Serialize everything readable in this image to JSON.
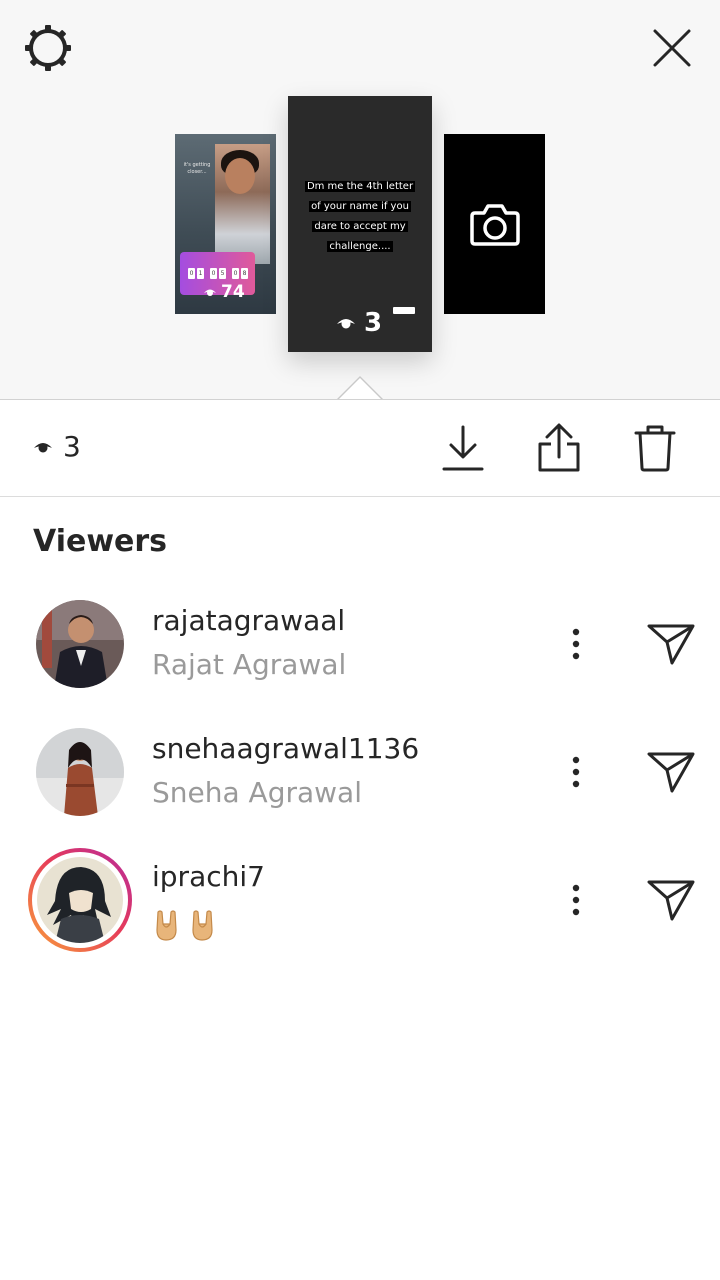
{
  "header": {
    "settings_icon": "gear-icon",
    "close_icon": "close-icon"
  },
  "stories": {
    "left": {
      "caption": "it's getting closer...",
      "countdown_digits": [
        "0",
        "1",
        "0",
        "5",
        "0",
        "8"
      ],
      "views": "74"
    },
    "center": {
      "text": "Dm me the 4th letter of your name if you dare to accept my challenge....",
      "views": "3"
    },
    "right": {
      "icon": "camera-icon"
    }
  },
  "action_bar": {
    "views": "3",
    "download_icon": "download-icon",
    "share_icon": "share-icon",
    "delete_icon": "trash-icon"
  },
  "viewers": {
    "title": "Viewers",
    "list": [
      {
        "username": "rajatagrawaal",
        "name": "Rajat Agrawal"
      },
      {
        "username": "snehaagrawal1136",
        "name": "Sneha Agrawal"
      },
      {
        "username": "iprachi7",
        "name": "🤘🤘"
      }
    ]
  },
  "colors": {
    "top_background": "#f7f7f7",
    "text_primary": "#262626",
    "text_secondary": "#9a9a9a",
    "story_ring_start": "#f9a13a",
    "story_ring_end": "#b52aa0"
  }
}
